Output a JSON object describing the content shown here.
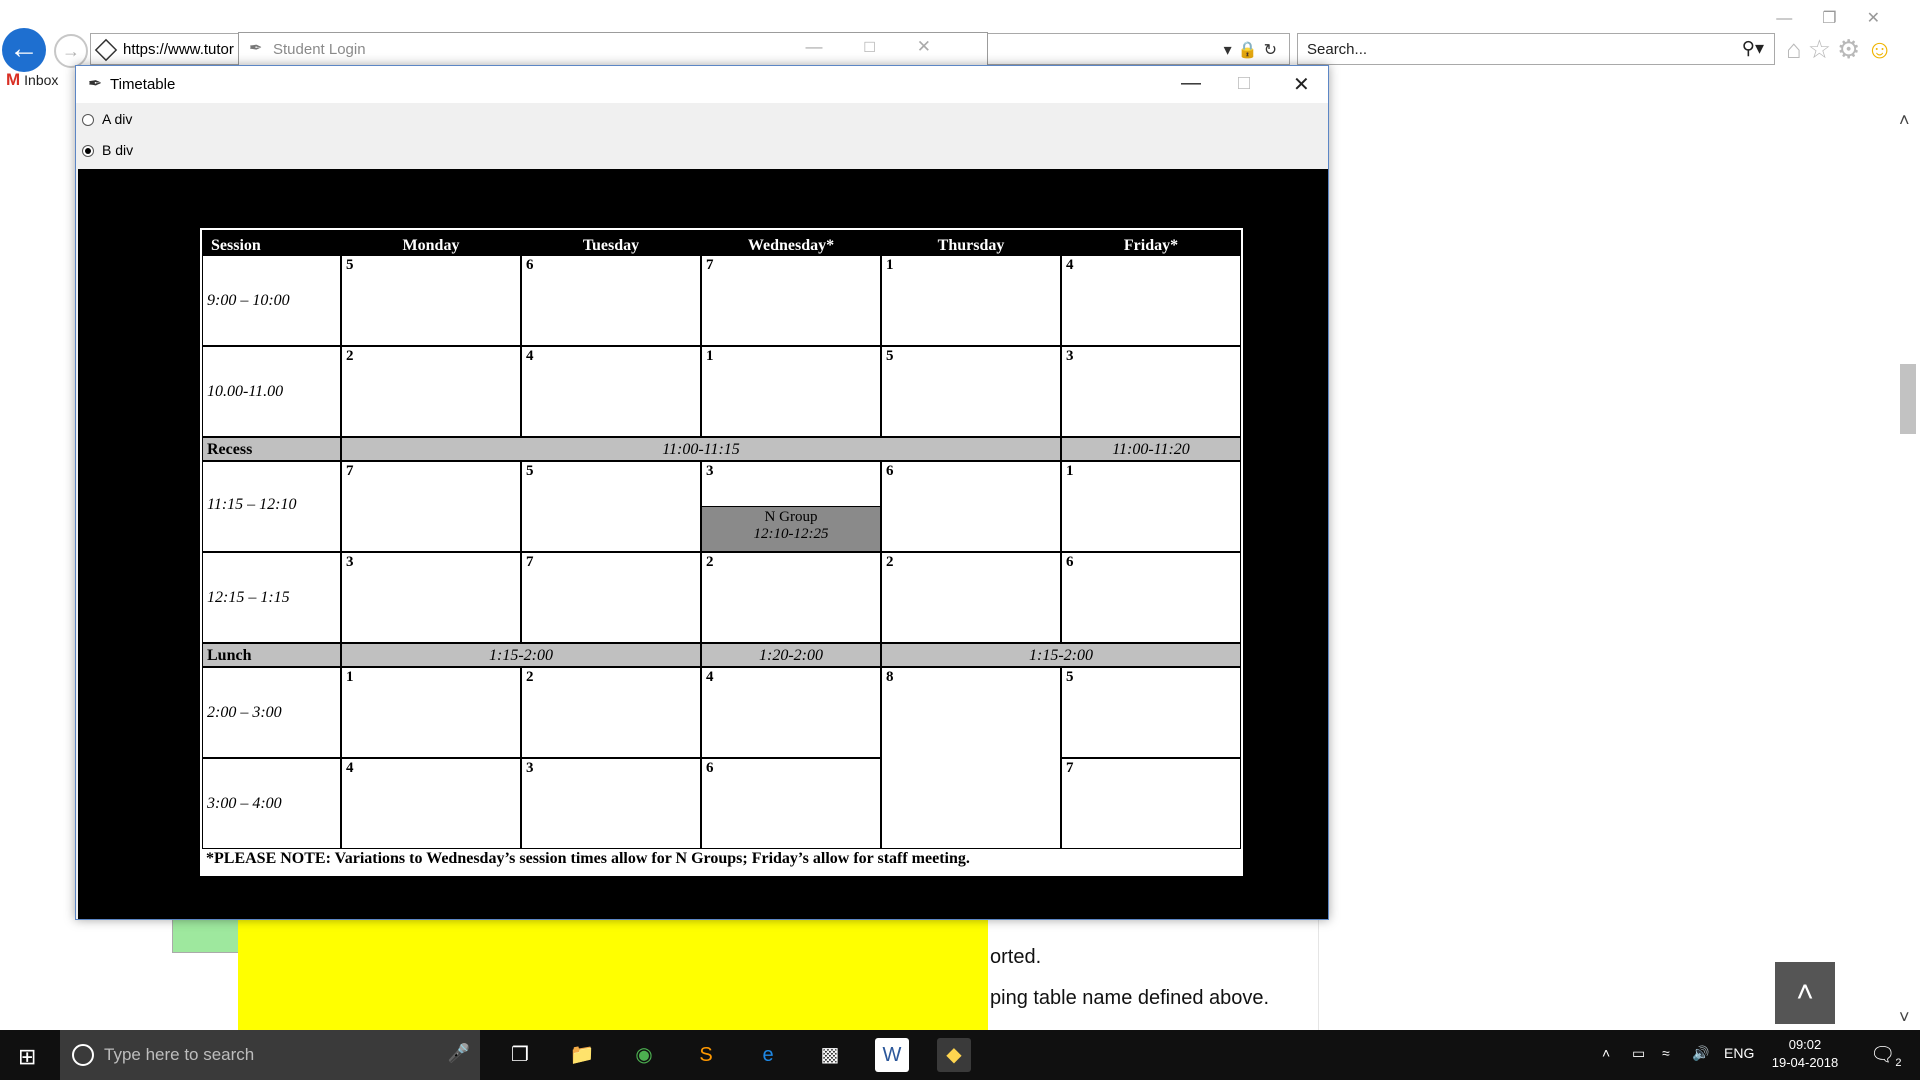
{
  "browser": {
    "url": "https://www.tutor",
    "search_placeholder": "Search...",
    "favorites": [
      {
        "label": "Inbox"
      }
    ]
  },
  "student_login_window": {
    "title": "Student Login"
  },
  "timetable_window": {
    "title": "Timetable",
    "radios": [
      {
        "label": "A div",
        "checked": false
      },
      {
        "label": "B div",
        "checked": true
      }
    ]
  },
  "timetable": {
    "headers": [
      "Session",
      "Monday",
      "Tuesday",
      "Wednesday*",
      "Thursday",
      "Friday*"
    ],
    "recess": {
      "label": "Recess",
      "times": [
        "11:00-11:15",
        "11:00-11:20"
      ]
    },
    "lunch": {
      "label": "Lunch",
      "times": [
        "1:15-2:00",
        "1:20-2:00",
        "1:15-2:00"
      ]
    },
    "rows": [
      {
        "time": "9:00 – 10:00",
        "cells": [
          "5",
          "6",
          "7",
          "1",
          "4"
        ]
      },
      {
        "time": "10.00-11.00",
        "cells": [
          "2",
          "4",
          "1",
          "5",
          "3"
        ]
      },
      {
        "time": "11:15 – 12:10",
        "cells": [
          "7",
          "5",
          "3",
          "6",
          "1"
        ]
      },
      {
        "time": "12:15 – 1:15",
        "cells": [
          "3",
          "7",
          "2",
          "2",
          "6"
        ]
      },
      {
        "time": "2:00 – 3:00",
        "cells": [
          "1",
          "2",
          "4",
          "8",
          "5"
        ]
      },
      {
        "time": "3:00 – 4:00",
        "cells": [
          "4",
          "3",
          "6",
          "",
          "7"
        ]
      }
    ],
    "n_group": {
      "label": "N Group",
      "time": "12:10-12:25"
    },
    "note": "*PLEASE NOTE:  Variations to Wednesday’s session times allow for N Groups; Friday’s allow for staff meeting."
  },
  "page_behind": {
    "text_line1": "orted.",
    "text_line2": "ping table name defined above."
  },
  "taskbar": {
    "search_placeholder": "Type here to search",
    "language": "ENG",
    "time": "09:02",
    "date": "19-04-2018",
    "notification_count": "2"
  }
}
